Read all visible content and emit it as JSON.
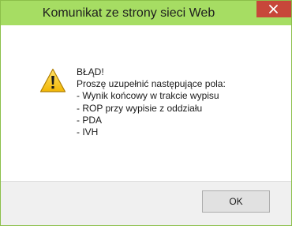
{
  "dialog": {
    "title": "Komunikat ze strony sieci Web",
    "close_icon": "close-icon",
    "warning_icon": "warning-triangle-icon",
    "message_lines": [
      "BŁĄD!",
      "Proszę uzupełnić następujące pola:",
      "- Wynik końcowy w trakcie wypisu",
      "- ROP przy wypisie z oddziału",
      "- PDA",
      "- IVH"
    ],
    "ok_label": "OK"
  },
  "colors": {
    "titlebar": "#a6dd63",
    "close_button": "#c7473a",
    "footer": "#f0f0f0"
  }
}
